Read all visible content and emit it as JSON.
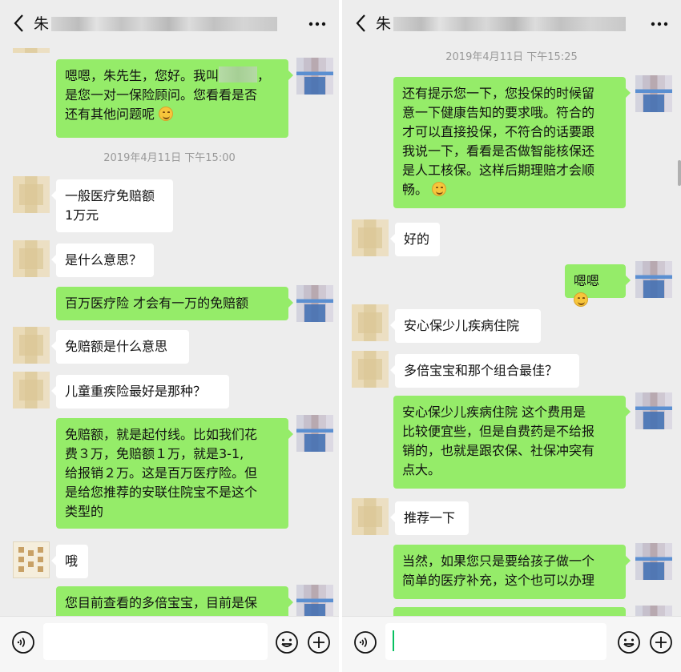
{
  "left": {
    "header": {
      "back": "<",
      "name": "朱"
    },
    "messages": {
      "m1": {
        "text": "嗯嗯，朱先生，您好。我叫",
        "sep": "，",
        "line2": "是您一对一保险顾问。您看看是否",
        "line3": "还有其他问题呢"
      },
      "time1": "2019年4月11日 下午15:00",
      "m2a": "一般医疗免赔额",
      "m2b": "1万元",
      "m3": "是什么意思？",
      "m4": "百万医疗险  才会有一万的免赔额",
      "m5": "免赔额是什么意思",
      "m6": "儿童重疾险最好是那种？",
      "m7": [
        "免赔额，就是起付线。比如我们花",
        "费３万，免赔额１万，就是3-1,",
        "给报销２万。这是百万医疗险。但",
        "是给您推荐的安联住院宝不是这个",
        "类型的"
      ],
      "m8": "哦",
      "m9": "您目前查看的多倍宝宝，目前是保"
    },
    "input": {
      "value": ""
    }
  },
  "right": {
    "header": {
      "back": "<",
      "name": "朱"
    },
    "messages": {
      "time1": "2019年4月11日 下午15:25",
      "r1": [
        "还有提示您一下，您投保的时候留",
        "意一下健康告知的要求哦。符合的",
        "才可以直接投保，不符合的话要跟",
        "我说一下，看看是否做智能核保还",
        "是人工核保。这样后期理赔才会顺"
      ],
      "r1_last": "畅。",
      "r2": "好的",
      "r3": "嗯嗯",
      "r4": "安心保少儿疾病住院",
      "r5": "多倍宝宝和那个组合最佳？",
      "r6": [
        "安心保少儿疾病住院  这个费用是",
        "比较便宜些，但是自费药是不给报",
        "销的，也就是跟农保、社保冲突有",
        "点大。"
      ],
      "r7": "推荐一下",
      "r8": [
        "当然，如果您只是要给孩子做一个",
        "简单的医疗补充，这个也可以办理"
      ]
    },
    "input": {
      "value": ""
    }
  },
  "icons": {
    "back": "chevron-left-icon",
    "more": "more-dots-icon",
    "voice": "voice-icon",
    "emoji": "emoji-icon",
    "plus": "plus-icon"
  },
  "colors": {
    "bubble_self": "#95ec69",
    "bubble_other": "#ffffff",
    "background": "#ededed",
    "timestamp": "#999999",
    "caret": "#07c160"
  }
}
